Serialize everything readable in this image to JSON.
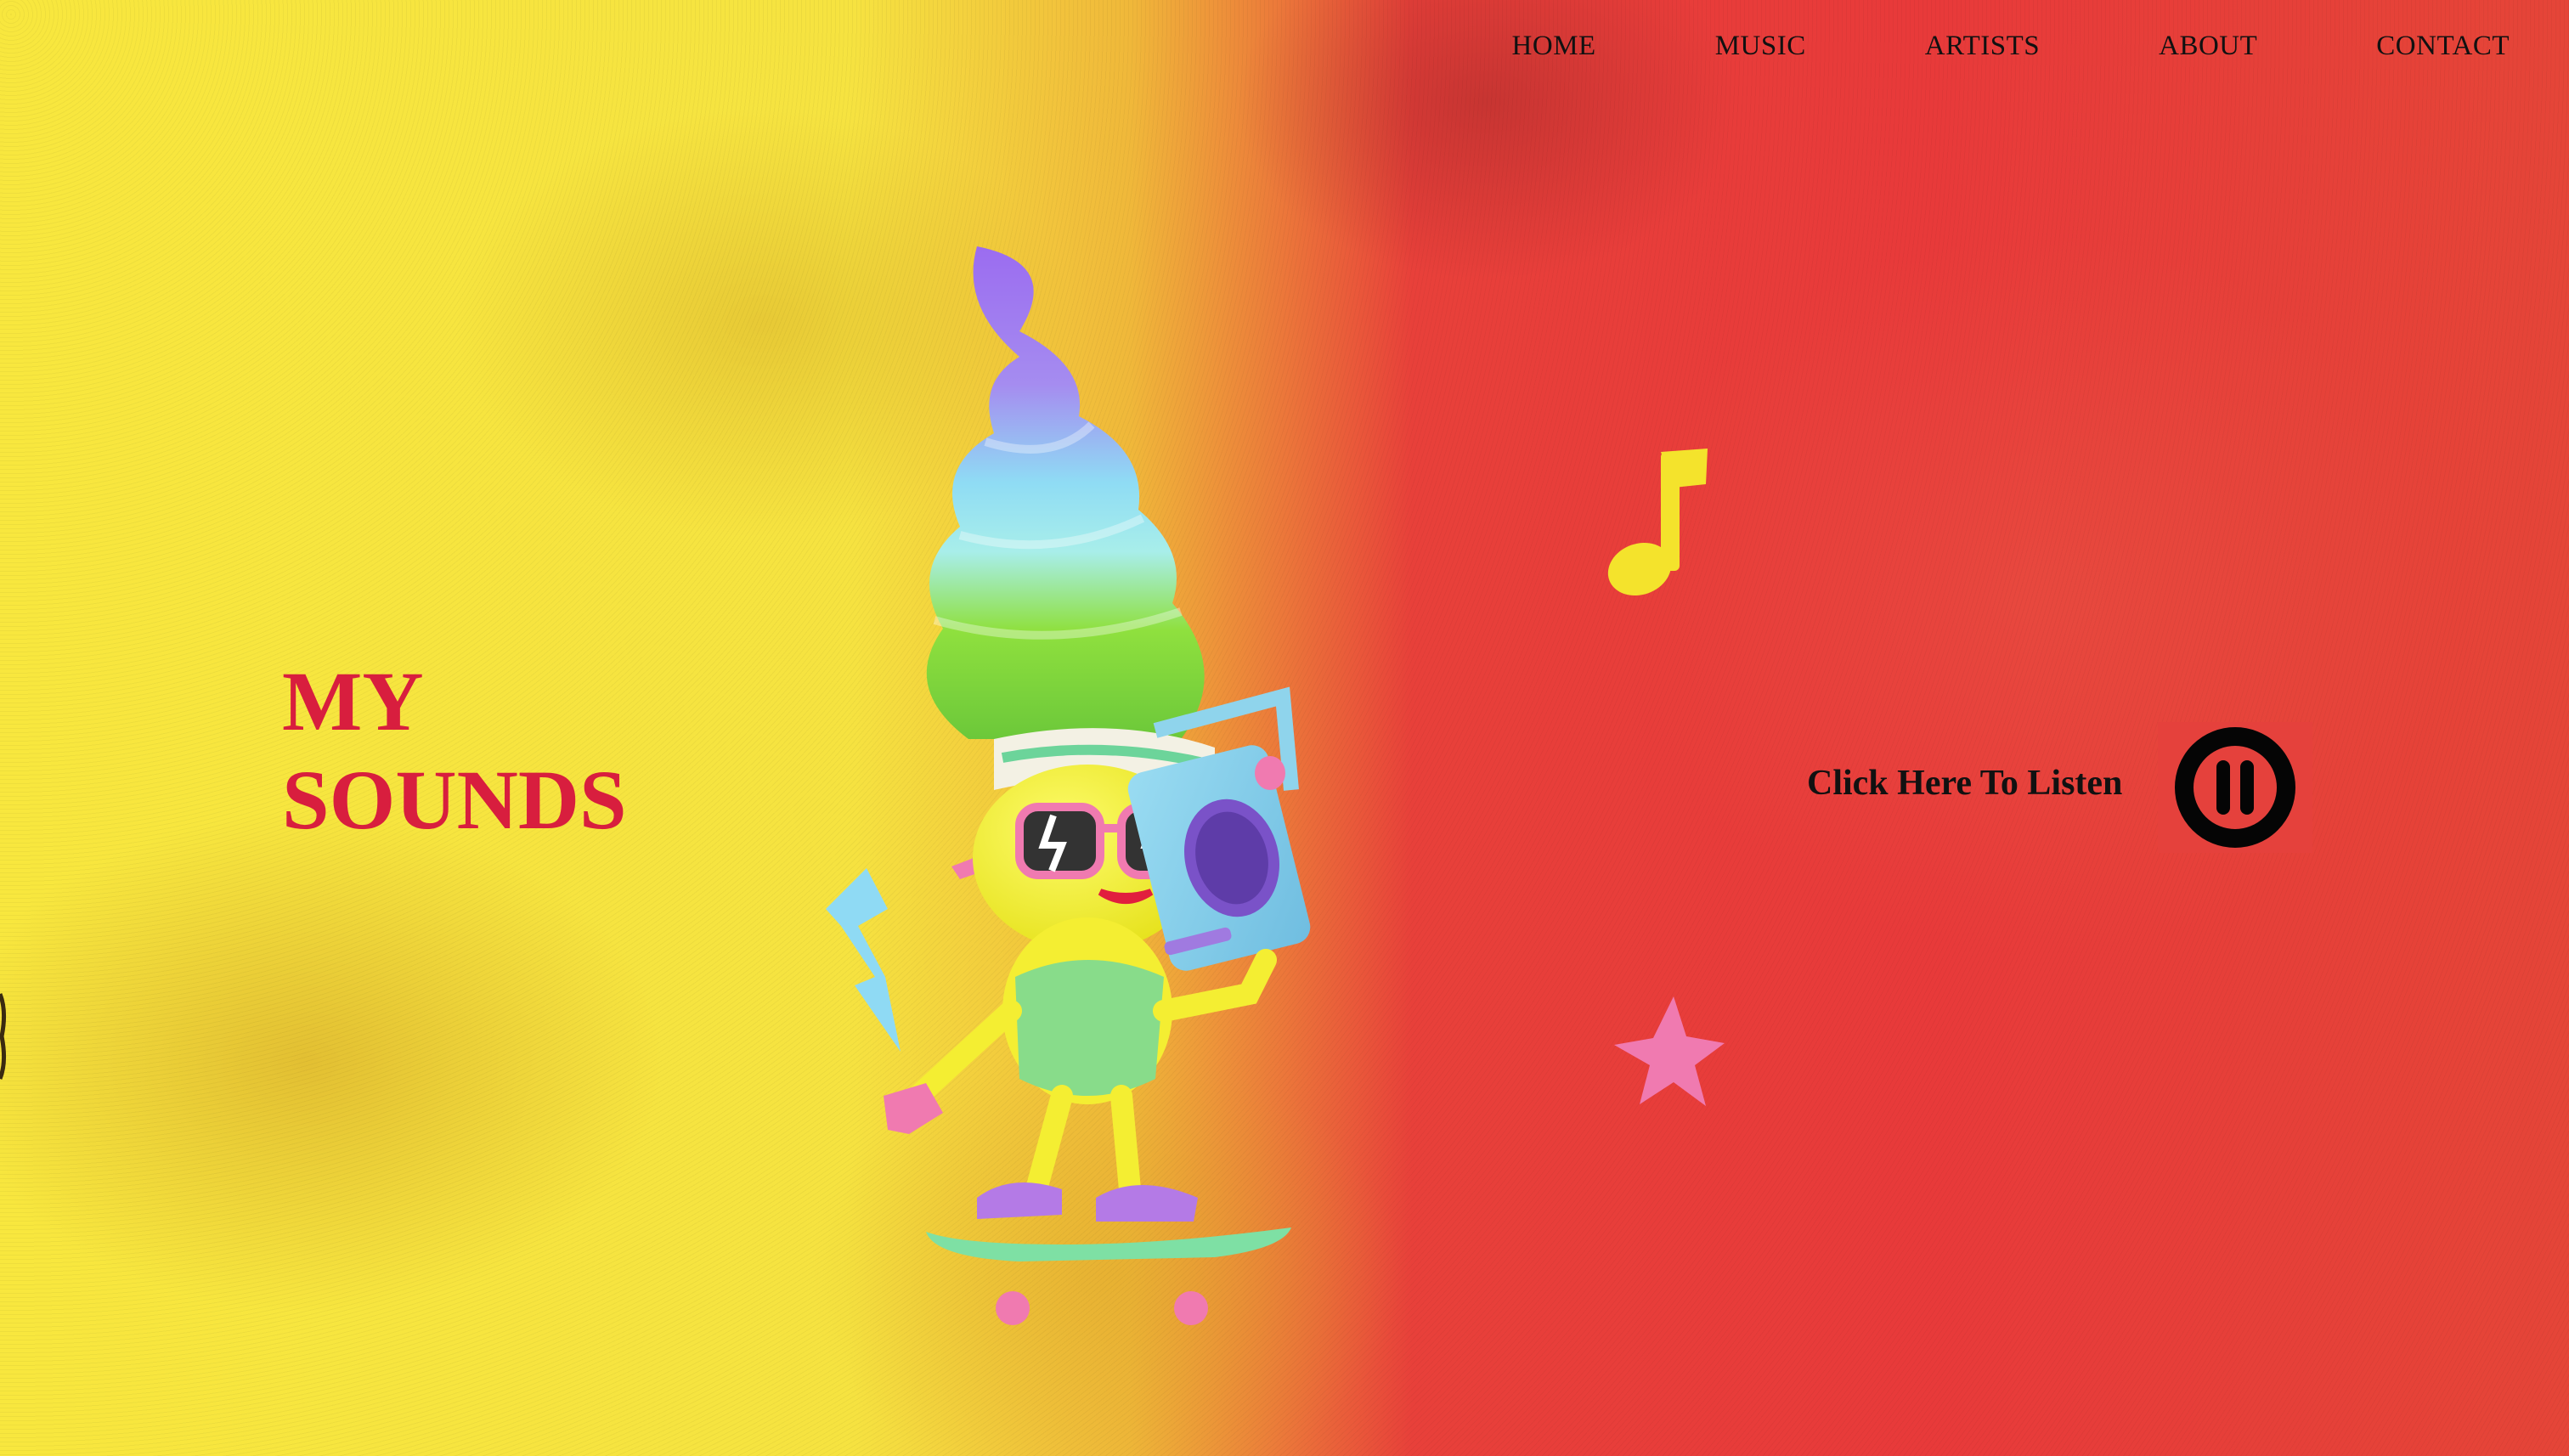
{
  "nav": {
    "items": [
      {
        "label": "HOME"
      },
      {
        "label": "MUSIC"
      },
      {
        "label": "ARTISTS"
      },
      {
        "label": "ABOUT"
      },
      {
        "label": "CONTACT"
      }
    ]
  },
  "hero": {
    "title_line1": "MY",
    "title_line2": "SOUNDS",
    "cta_label": "Click Here To Listen",
    "play_state_icon": "pause-icon"
  },
  "colors": {
    "title": "#d81e3e",
    "bg_left": "#f8e73e",
    "bg_right": "#e83a3a",
    "nav_text": "#111111"
  }
}
